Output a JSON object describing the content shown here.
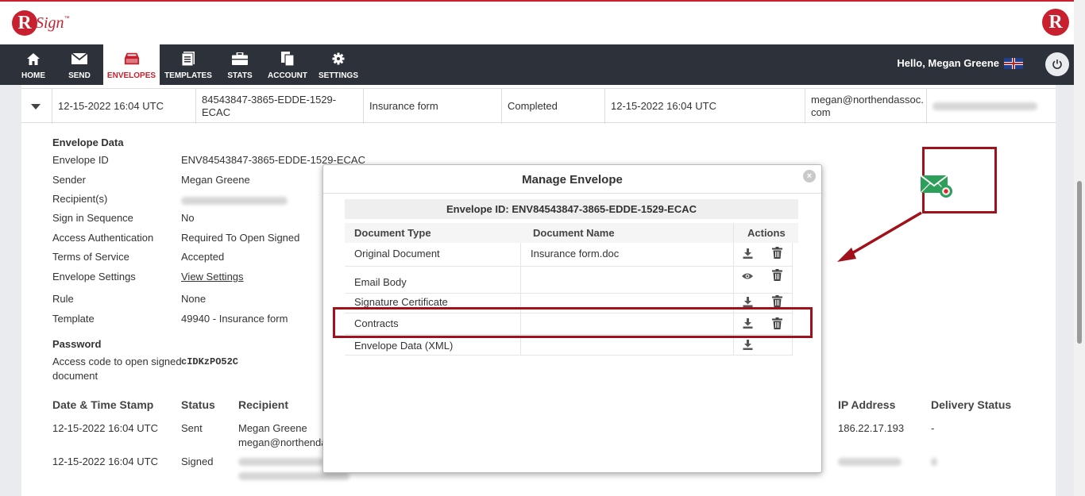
{
  "brand": {
    "logo_letter": "R",
    "logo_word": "Sign",
    "logo_tm": "™"
  },
  "nav": {
    "items": [
      {
        "label": "HOME"
      },
      {
        "label": "SEND"
      },
      {
        "label": "ENVELOPES"
      },
      {
        "label": "TEMPLATES"
      },
      {
        "label": "STATS"
      },
      {
        "label": "ACCOUNT"
      },
      {
        "label": "SETTINGS"
      }
    ],
    "greeting": "Hello, Megan Greene"
  },
  "envelope_row": {
    "sent_date": "12-15-2022 16:04 UTC",
    "envelope_code": "84543847-3865-EDDE-1529-ECAC",
    "subject": "Insurance form",
    "status": "Completed",
    "completed_date": "12-15-2022 16:04 UTC",
    "sender_email": "megan@northendassoc.\ncom"
  },
  "envelope_data": {
    "title": "Envelope Data",
    "fields": [
      {
        "label": "Envelope ID",
        "value": "ENV84543847-3865-EDDE-1529-ECAC"
      },
      {
        "label": "Sender",
        "value": "Megan Greene"
      },
      {
        "label": "Recipient(s)",
        "value": ""
      },
      {
        "label": "Sign in Sequence",
        "value": "No"
      },
      {
        "label": "Access Authentication",
        "value": "Required To Open Signed"
      },
      {
        "label": "Terms of Service",
        "value": "Accepted"
      },
      {
        "label": "Envelope Settings",
        "value": "View Settings"
      },
      {
        "label": "Rule",
        "value": "None"
      },
      {
        "label": "Template",
        "value": "49940 - Insurance form"
      }
    ],
    "password_title": "Password",
    "access_label": "Access code to open signed",
    "access_label2": "document",
    "access_code": "cIDKzPO52C"
  },
  "history": {
    "headers": {
      "date": "Date & Time Stamp",
      "status": "Status",
      "recipient": "Recipient",
      "ip": "IP Address",
      "delivery": "Delivery Status"
    },
    "rows": [
      {
        "date": "12-15-2022 16:04 UTC",
        "status": "Sent",
        "recipient": "Megan Greene",
        "recipient2": "megan@northenda",
        "ip": "186.22.17.193",
        "delivery": "-"
      },
      {
        "date": "12-15-2022 16:04 UTC",
        "status": "Signed"
      }
    ]
  },
  "modal": {
    "title": "Manage Envelope",
    "close": "×",
    "envelope_id": "Envelope ID: ENV84543847-3865-EDDE-1529-ECAC",
    "headers": {
      "type": "Document Type",
      "name": "Document Name",
      "actions": "Actions"
    },
    "rows": [
      {
        "type": "Original Document",
        "name": "Insurance form.doc",
        "actions": [
          "download",
          "delete"
        ]
      },
      {
        "type": "Email Body",
        "name": "",
        "actions": [
          "view",
          "delete"
        ]
      },
      {
        "type": "Signature Certificate",
        "name": "",
        "actions": [
          "download",
          "delete"
        ]
      },
      {
        "type": "Contracts",
        "name": "",
        "actions": [
          "download",
          "delete"
        ]
      },
      {
        "type": "Envelope Data (XML)",
        "name": "",
        "actions": [
          "download"
        ]
      }
    ]
  },
  "colors": {
    "brand_red": "#c8202f",
    "nav_bg": "#2d3139",
    "annotation_red": "#a0111b",
    "mail_green": "#2e9e5b"
  }
}
